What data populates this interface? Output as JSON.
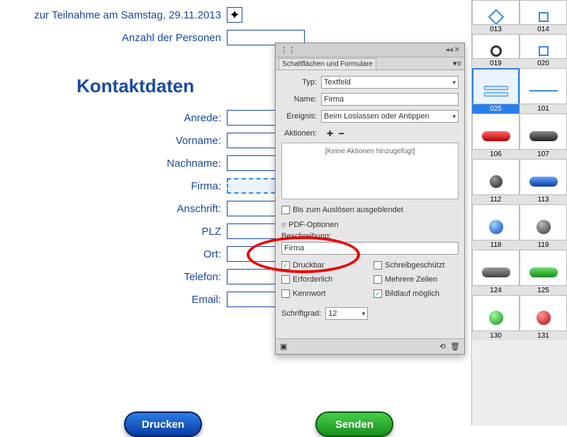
{
  "form": {
    "saturday_label": "zur Teilnahme am Samstag, 29.11.2013",
    "persons_label": "Anzahl der Personen",
    "section": "Kontaktdaten",
    "fields": {
      "anrede": "Anrede:",
      "vorname": "Vorname:",
      "nachname": "Nachname:",
      "firma": "Firma:",
      "anschrift": "Anschrift:",
      "plz": "PLZ",
      "ort": "Ort:",
      "telefon": "Telefon:",
      "email": "Email:"
    },
    "buttons": {
      "print": "Drucken",
      "send": "Senden"
    }
  },
  "panel": {
    "title": "Schaltflächen und Formulare",
    "rows": {
      "type_label": "Typ:",
      "type_value": "Textfeld",
      "name_label": "Name:",
      "name_value": "Firma",
      "event_label": "Ereignis:",
      "event_value": "Beim Loslassen oder Antippen",
      "actions_label": "Aktionen:"
    },
    "actions_empty": "[Keine Aktionen hinzugefügt]",
    "chk_hidden": "Bis zum Auslösen ausgeblendet",
    "pdf_section": "PDF-Optionen",
    "desc_label": "Beschreibung:",
    "desc_value": "Firma",
    "opts": {
      "druckbar": "Druckbar",
      "schreibg": "Schreibgeschützt",
      "erforderlich": "Erforderlich",
      "mehrere": "Mehrere Zeilen",
      "kennwort": "Kennwort",
      "bildlauf": "Bildlauf möglich"
    },
    "opts_checked": {
      "druckbar": true,
      "bildlauf": true
    },
    "font_label": "Schriftgrad:",
    "font_value": "12"
  },
  "library": {
    "items": [
      {
        "id": "013",
        "kind": "diamond"
      },
      {
        "id": "014",
        "kind": "square"
      },
      {
        "id": "019",
        "kind": "ring"
      },
      {
        "id": "020",
        "kind": "square"
      },
      {
        "id": "025",
        "kind": "bars",
        "selected": true
      },
      {
        "id": "101",
        "kind": "line"
      },
      {
        "id": "106",
        "kind": "pill",
        "color": "linear-gradient(#ff6a6a,#b80000)"
      },
      {
        "id": "107",
        "kind": "pill",
        "color": "linear-gradient(#888,#222)"
      },
      {
        "id": "112",
        "kind": "ball",
        "color": "radial-gradient(circle at 35% 30%,#999,#222)"
      },
      {
        "id": "113",
        "kind": "pill",
        "color": "linear-gradient(#6aa6ff,#0a3ca0)"
      },
      {
        "id": "118",
        "kind": "orb",
        "color": "radial-gradient(circle at 35% 30%,#9cd4ff,#0a4ac0)"
      },
      {
        "id": "119",
        "kind": "orb",
        "color": "radial-gradient(circle at 35% 30%,#bbb,#333)"
      },
      {
        "id": "124",
        "kind": "pill",
        "color": "linear-gradient(#999,#444)"
      },
      {
        "id": "125",
        "kind": "pill",
        "color": "linear-gradient(#6ae06a,#1a8c1e)"
      },
      {
        "id": "130",
        "kind": "orb",
        "color": "radial-gradient(circle at 35% 30%,#9cff9c,#1a8c1e)"
      },
      {
        "id": "131",
        "kind": "orb",
        "color": "radial-gradient(circle at 35% 30%,#ff9c9c,#b80000)"
      }
    ]
  }
}
